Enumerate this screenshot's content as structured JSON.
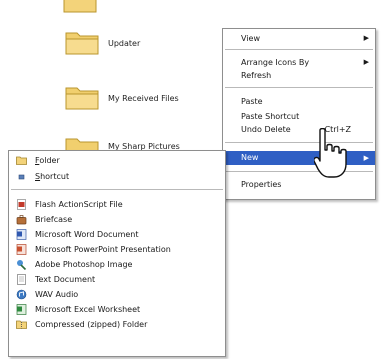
{
  "desktop": {
    "items": [
      {
        "label": ""
      },
      {
        "label": "Updater"
      },
      {
        "label": "My Received Files"
      },
      {
        "label": "My Sharp Pictures"
      }
    ]
  },
  "context_menu": {
    "view": "View",
    "arrange": "Arrange Icons By",
    "refresh": "Refresh",
    "paste": "Paste",
    "paste_shortcut": "Paste Shortcut",
    "undo_delete": "Undo Delete",
    "undo_shortcut": "Ctrl+Z",
    "new": "New",
    "properties": "Properties"
  },
  "new_submenu": {
    "folder_accel": "F",
    "folder_rest": "older",
    "shortcut_accel": "S",
    "shortcut_rest": "hortcut",
    "items": [
      "Flash ActionScript File",
      "Briefcase",
      "Microsoft Word Document",
      "Microsoft PowerPoint Presentation",
      "Adobe Photoshop Image",
      "Text Document",
      "WAV Audio",
      "Microsoft Excel Worksheet",
      "Compressed (zipped) Folder"
    ]
  },
  "colors": {
    "highlight": "#2f5fc4",
    "folder": "#f3d37a"
  },
  "icons": [
    "folder-icon",
    "shortcut-icon",
    "flash-file-icon",
    "briefcase-icon",
    "word-icon",
    "powerpoint-icon",
    "photoshop-icon",
    "text-document-icon",
    "wav-audio-icon",
    "excel-icon",
    "zip-folder-icon",
    "mouse-cursor-icon",
    "submenu-arrow-icon"
  ]
}
